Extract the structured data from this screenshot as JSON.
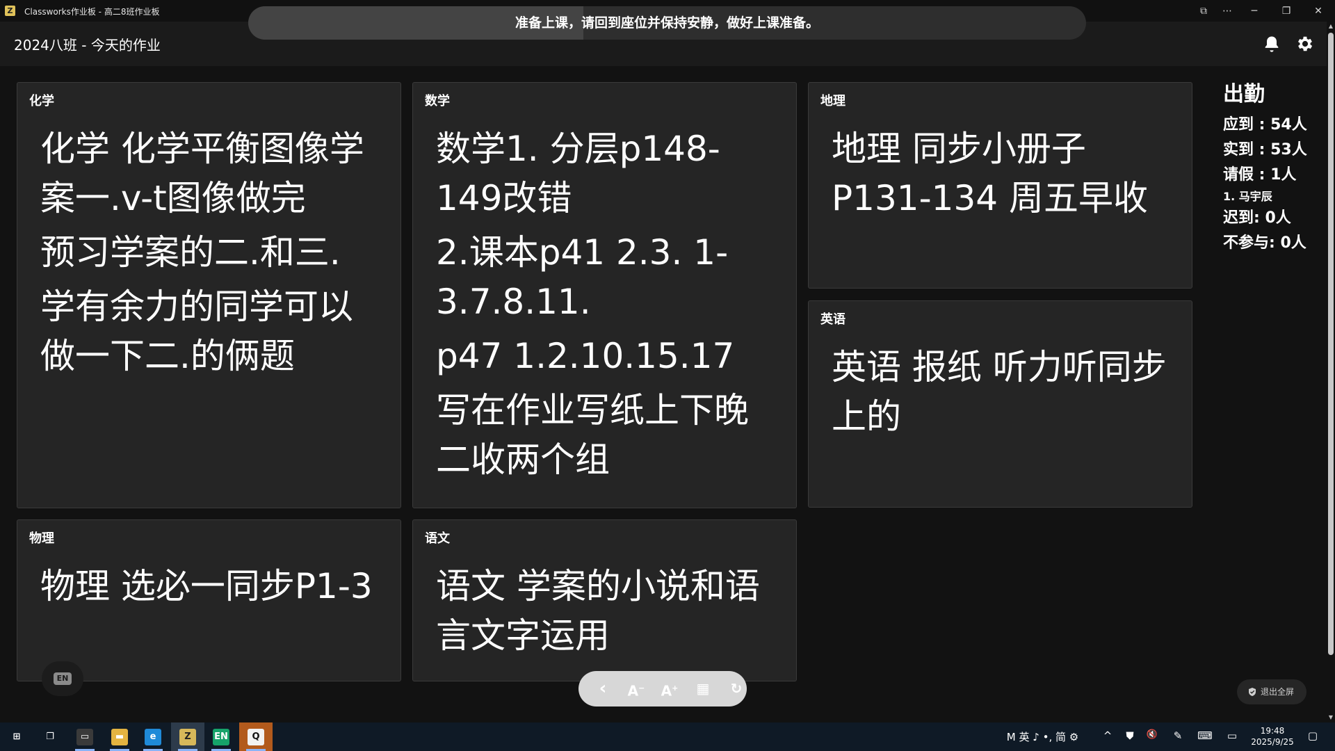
{
  "window": {
    "title": "Classworks作业板 - 高二8班作业板",
    "logo": "Z",
    "controls": [
      "⧉",
      "⋯",
      "─",
      "❐",
      "✕"
    ]
  },
  "notice": {
    "text": "准备上课，请回到座位并保持安静，做好上课准备。",
    "progress_percent": 40
  },
  "header": {
    "title": "2024八班 - 今天的作业"
  },
  "subjects": {
    "chemistry": {
      "label": "化学",
      "lines": [
        "化学 化学平衡图像学案一.v-t图像做完",
        "预习学案的二.和三.",
        "学有余力的同学可以做一下二.的俩题"
      ]
    },
    "math": {
      "label": "数学",
      "lines": [
        "数学1. 分层p148-149改错",
        "2.课本p41 2.3. 1-3.7.8.11.",
        "p47 1.2.10.15.17",
        "写在作业写纸上下晚二收两个组"
      ]
    },
    "geography": {
      "label": "地理",
      "lines": [
        "地理 同步小册子P131-134 周五早收"
      ]
    },
    "english": {
      "label": "英语",
      "lines": [
        "英语 报纸 听力听同步上的"
      ]
    },
    "physics": {
      "label": "物理",
      "lines": [
        "物理 选必一同步P1-3"
      ]
    },
    "chinese": {
      "label": "语文",
      "lines": [
        "语文 学案的小说和语言文字运用"
      ]
    }
  },
  "attendance": {
    "title": "出勤",
    "expected": "应到 : 54人",
    "actual": "实到 : 53人",
    "leave": "请假 : 1人",
    "leave_names": [
      "1. 马宇辰"
    ],
    "late": "迟到: 0人",
    "absent": "不参与: 0人"
  },
  "toolbar": {
    "back": "‹",
    "font_decrease": "A",
    "font_increase": "A",
    "calendar": "▦",
    "refresh": "↻"
  },
  "ime_badge": "EN",
  "exit_fullscreen": "退出全屏",
  "taskbar": {
    "apps": [
      {
        "name": "start",
        "glyph": "⊞",
        "color": "transparent"
      },
      {
        "name": "task-view",
        "glyph": "❐",
        "color": "transparent"
      },
      {
        "name": "app-dark",
        "glyph": "▭",
        "color": "#3a3a3a"
      },
      {
        "name": "file-explorer",
        "glyph": "▬",
        "color": "#e3b341"
      },
      {
        "name": "edge",
        "glyph": "e",
        "color": "#1f8ad8"
      },
      {
        "name": "classworks",
        "glyph": "Z",
        "color": "#d7b85a"
      },
      {
        "name": "en-app",
        "glyph": "EN",
        "color": "#16a36a"
      },
      {
        "name": "qq",
        "glyph": "Q",
        "color": "#f2f2f2"
      }
    ],
    "tray": {
      "ime": "M 英 ♪ •, 简 ⚙",
      "chevron": "^",
      "security": "⛊",
      "volume": "🔇",
      "pen": "✎",
      "keyboard": "⌨",
      "display": "▭",
      "notification": "▢"
    },
    "time": "19:48",
    "date": "2025/9/25"
  }
}
